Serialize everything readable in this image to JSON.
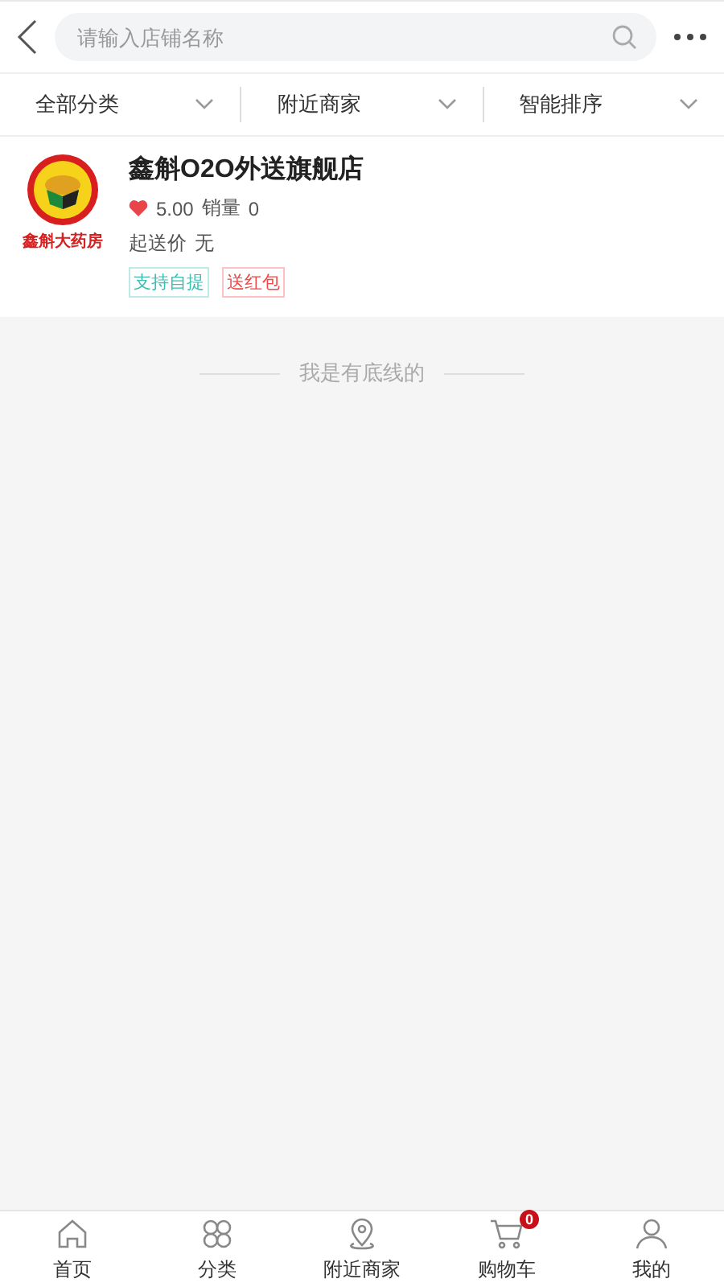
{
  "search": {
    "placeholder": "请输入店铺名称"
  },
  "filters": [
    {
      "label": "全部分类"
    },
    {
      "label": "附近商家"
    },
    {
      "label": "智能排序"
    }
  ],
  "shop": {
    "logo_text": "鑫斛大药房",
    "name": "鑫斛O2O外送旗舰店",
    "rating": "5.00",
    "sales_label": "销量",
    "sales": "0",
    "min_order_label": "起送价",
    "min_order": "无",
    "tags": [
      {
        "label": "支持自提",
        "color": "#3bbfb0"
      },
      {
        "label": "送红包",
        "color": "#f04848"
      }
    ]
  },
  "end_note": "我是有底线的",
  "tabs": [
    {
      "label": "首页",
      "kind": "home",
      "selected": false
    },
    {
      "label": "分类",
      "kind": "grid",
      "selected": false
    },
    {
      "label": "附近商家",
      "kind": "pin",
      "selected": false
    },
    {
      "label": "购物车",
      "kind": "cart",
      "selected": false,
      "badge": "0"
    },
    {
      "label": "我的",
      "kind": "user",
      "selected": false
    }
  ]
}
